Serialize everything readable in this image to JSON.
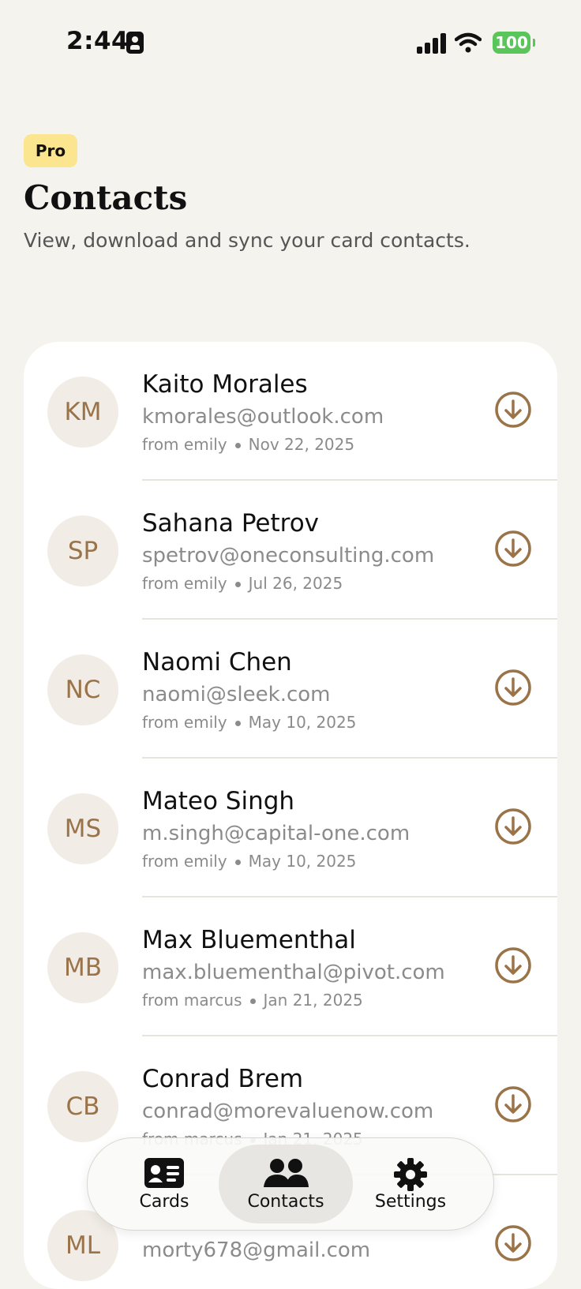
{
  "status_bar": {
    "time": "2:44",
    "battery": "100"
  },
  "header": {
    "badge": "Pro",
    "title": "Contacts",
    "subtitle": "View, download and sync your card contacts."
  },
  "contacts": [
    {
      "initials": "KM",
      "name": "Kaito Morales",
      "email": "kmorales@outlook.com",
      "from": "from emily",
      "date": "Nov 22, 2025"
    },
    {
      "initials": "SP",
      "name": "Sahana Petrov",
      "email": "spetrov@oneconsulting.com",
      "from": "from emily",
      "date": "Jul 26, 2025"
    },
    {
      "initials": "NC",
      "name": "Naomi Chen",
      "email": "naomi@sleek.com",
      "from": "from emily",
      "date": "May 10, 2025"
    },
    {
      "initials": "MS",
      "name": "Mateo Singh",
      "email": "m.singh@capital-one.com",
      "from": "from emily",
      "date": "May 10, 2025"
    },
    {
      "initials": "MB",
      "name": "Max Bluementhal",
      "email": "max.bluementhal@pivot.com",
      "from": "from marcus",
      "date": "Jan 21, 2025"
    },
    {
      "initials": "CB",
      "name": "Conrad Brem",
      "email": "conrad@morevaluenow.com",
      "from": "from marcus",
      "date": "Jan 21, 2025"
    },
    {
      "initials": "ML",
      "name": "",
      "email": "morty678@gmail.com",
      "from": "",
      "date": ""
    }
  ],
  "tabs": [
    {
      "label": "Cards",
      "icon": "id-card-icon"
    },
    {
      "label": "Contacts",
      "icon": "people-icon"
    },
    {
      "label": "Settings",
      "icon": "gear-icon"
    }
  ],
  "colors": {
    "accent": "#9a7349",
    "badge_bg": "#fbe58e",
    "page_bg": "#f4f3ee"
  }
}
